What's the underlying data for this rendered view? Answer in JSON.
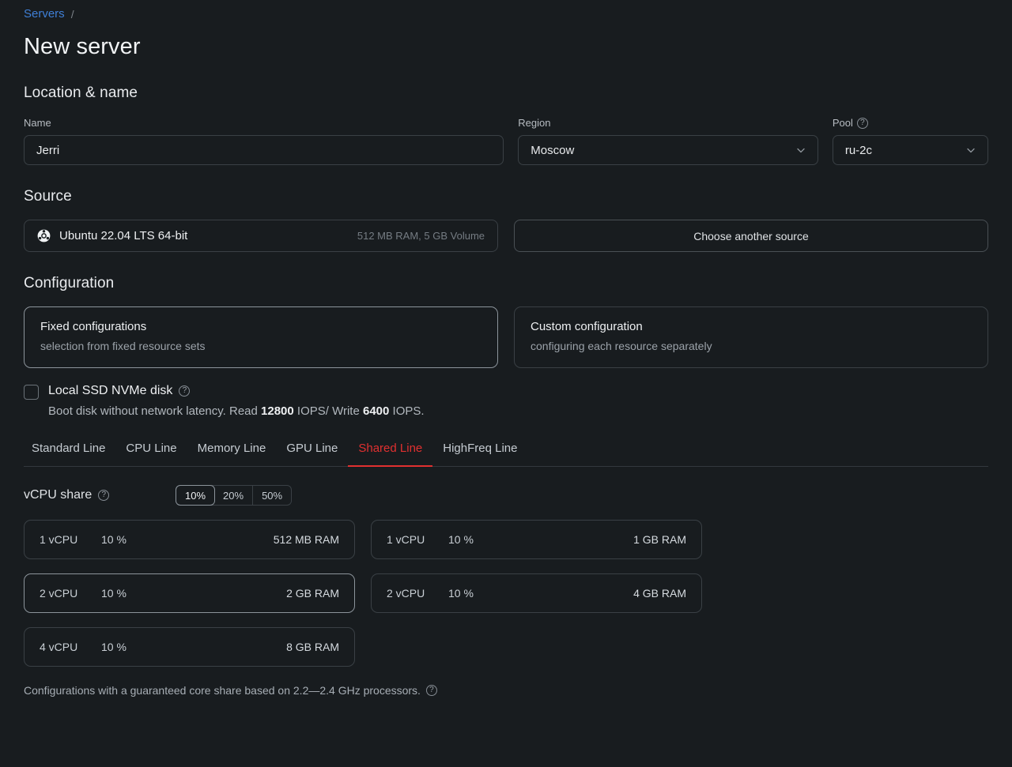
{
  "breadcrumb": {
    "parent": "Servers",
    "separator": "/"
  },
  "page_title": "New server",
  "colors": {
    "background": "#181c1f",
    "link": "#3f7fd6",
    "accent_red": "#e13030",
    "border": "#3a4045",
    "border_selected": "#8c949b"
  },
  "location_section": {
    "title": "Location & name",
    "name_field": {
      "label": "Name",
      "value": "Jerri"
    },
    "region_field": {
      "label": "Region",
      "value": "Moscow"
    },
    "pool_field": {
      "label": "Pool",
      "value": "ru-2c",
      "help": "?"
    }
  },
  "source_section": {
    "title": "Source",
    "selected_source": {
      "icon": "ubuntu-icon",
      "name": "Ubuntu 22.04 LTS 64-bit",
      "meta": "512 MB RAM, 5 GB Volume"
    },
    "choose_another_label": "Choose another source"
  },
  "configuration_section": {
    "title": "Configuration",
    "options": [
      {
        "title": "Fixed configurations",
        "subtitle": "selection from fixed resource sets",
        "selected": true
      },
      {
        "title": "Custom configuration",
        "subtitle": "configuring each resource separately",
        "selected": false
      }
    ],
    "local_ssd": {
      "label": "Local SSD NVMe disk",
      "help": "?",
      "checked": false,
      "description_prefix": "Boot disk without network latency. Read ",
      "read_iops": "12800",
      "description_middle": " IOPS/ Write ",
      "write_iops": "6400",
      "description_suffix": " IOPS."
    },
    "tabs": [
      {
        "label": "Standard Line",
        "active": false
      },
      {
        "label": "CPU Line",
        "active": false
      },
      {
        "label": "Memory Line",
        "active": false
      },
      {
        "label": "GPU Line",
        "active": false
      },
      {
        "label": "Shared Line",
        "active": true
      },
      {
        "label": "HighFreq Line",
        "active": false
      }
    ],
    "vcpu_share": {
      "label": "vCPU share",
      "help": "?",
      "options": [
        "10%",
        "20%",
        "50%"
      ],
      "selected": "10%"
    },
    "plans": [
      {
        "cpu": "1 vCPU",
        "pct": "10 %",
        "ram": "512 MB RAM",
        "highlight": false
      },
      {
        "cpu": "1 vCPU",
        "pct": "10 %",
        "ram": "1 GB RAM",
        "highlight": false
      },
      {
        "cpu": "2 vCPU",
        "pct": "10 %",
        "ram": "2 GB RAM",
        "highlight": true
      },
      {
        "cpu": "2 vCPU",
        "pct": "10 %",
        "ram": "4 GB RAM",
        "highlight": false
      },
      {
        "cpu": "4 vCPU",
        "pct": "10 %",
        "ram": "8 GB RAM",
        "highlight": false
      }
    ],
    "footnote": "Configurations with a guaranteed core share based on 2.2—2.4 GHz processors.",
    "footnote_help": "?"
  }
}
